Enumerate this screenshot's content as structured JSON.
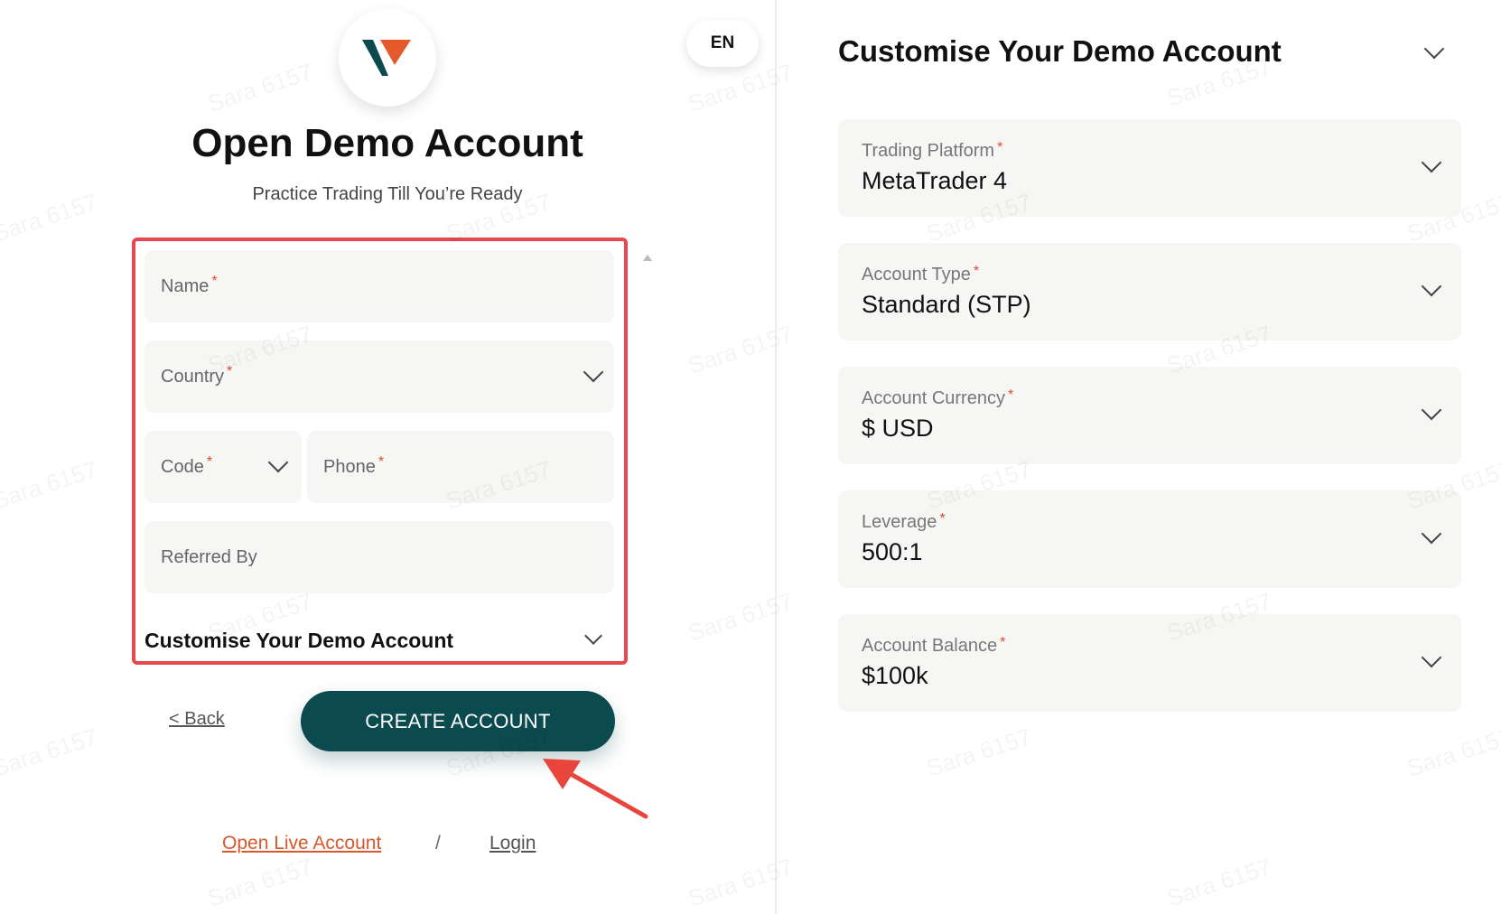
{
  "header": {
    "language": "EN",
    "title": "Open Demo Account",
    "subtitle": "Practice Trading Till You’re Ready"
  },
  "form": {
    "name_label": "Name",
    "country_label": "Country",
    "code_label": "Code",
    "phone_label": "Phone",
    "referred_label": "Referred By",
    "required_mark": "*",
    "customise_label": "Customise Your Demo Account"
  },
  "actions": {
    "back_label": "< Back",
    "create_label": "CREATE ACCOUNT"
  },
  "footer": {
    "live_label": "Open Live Account",
    "separator": "/",
    "login_label": "Login"
  },
  "customise": {
    "title": "Customise Your Demo Account",
    "fields": [
      {
        "label": "Trading Platform",
        "value": "MetaTrader 4"
      },
      {
        "label": "Account Type",
        "value": "Standard (STP)"
      },
      {
        "label": "Account Currency",
        "value": "$ USD"
      },
      {
        "label": "Leverage",
        "value": "500:1"
      },
      {
        "label": "Account Balance",
        "value": "$100k"
      }
    ]
  },
  "watermark": "Sara 6157",
  "colors": {
    "primary_button": "#0b4a4f",
    "highlight_border": "#e5484d",
    "required": "#e24a2c",
    "live_link": "#d9582c",
    "logo_dark": "#0b4a4f",
    "logo_orange": "#e45a2a"
  }
}
